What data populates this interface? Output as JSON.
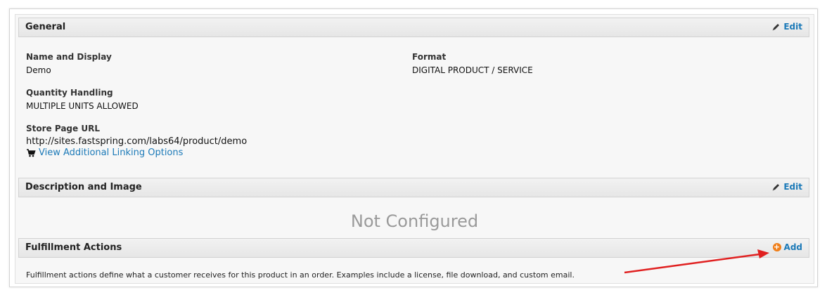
{
  "general": {
    "title": "General",
    "edit_label": "Edit",
    "name_label": "Name and Display",
    "name_value": "Demo",
    "format_label": "Format",
    "format_value": "DIGITAL PRODUCT / SERVICE",
    "quantity_label": "Quantity Handling",
    "quantity_value": "MULTIPLE UNITS ALLOWED",
    "url_label": "Store Page URL",
    "url_value": "http://sites.fastspring.com/labs64/product/demo",
    "linking_options": "View Additional Linking Options"
  },
  "description": {
    "title": "Description and Image",
    "edit_label": "Edit",
    "status": "Not Configured"
  },
  "fulfillment": {
    "title": "Fulfillment Actions",
    "add_label": "Add",
    "text": "Fulfillment actions define what a customer receives for this product in an order. Examples include a license, file download, and custom email."
  },
  "colors": {
    "link": "#1c7ab8",
    "add_icon": "#f07f1a",
    "annotation_arrow": "#e02020"
  }
}
